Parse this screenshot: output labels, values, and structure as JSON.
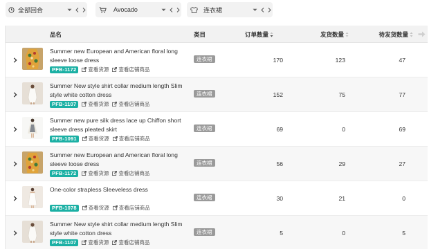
{
  "filters": [
    {
      "label": "全部回合",
      "icon": "clock-icon"
    },
    {
      "label": "Avocado",
      "icon": "cart-icon"
    },
    {
      "label": "连衣裙",
      "icon": "shirt-icon"
    }
  ],
  "table": {
    "headers": {
      "name": "品名",
      "category": "类目",
      "orders": "订单数量",
      "shipped": "发货数量",
      "pending": "待发货数量"
    },
    "link_source": "查看货源",
    "link_shop": "查看店铺商品",
    "rows": [
      {
        "title": "Summer new European and American floral long sleeve loose dress",
        "sku": "PFB-1172",
        "category": "连衣裙",
        "orders": "170",
        "shipped": "123",
        "pending": "47",
        "thumb": "floral"
      },
      {
        "title": "Summer New style shirt collar medium length Slim style white cotton dress",
        "sku": "PFB-1107",
        "category": "连衣裙",
        "orders": "152",
        "shipped": "75",
        "pending": "77",
        "thumb": "white"
      },
      {
        "title": "Summer new pure silk dress lace up Chiffon short sleeve dress pleated skirt",
        "sku": "PFB-1091",
        "category": "连衣裙",
        "orders": "69",
        "shipped": "0",
        "pending": "69",
        "thumb": "chiffon"
      },
      {
        "title": "Summer new European and American floral long sleeve loose dress",
        "sku": "PFB-1172",
        "category": "连衣裙",
        "orders": "56",
        "shipped": "29",
        "pending": "27",
        "thumb": "floral"
      },
      {
        "title": "One-color strapless Sleeveless dress",
        "sku": "PFB-1078",
        "category": "连衣裙",
        "orders": "30",
        "shipped": "21",
        "pending": "0",
        "thumb": "strapless"
      },
      {
        "title": "Summer New style shirt collar medium length Slim style white cotton dress",
        "sku": "PFB-1107",
        "category": "连衣裙",
        "orders": "5",
        "shipped": "0",
        "pending": "5",
        "thumb": "white"
      }
    ]
  },
  "colors": {
    "sku_badge": "#1bb0a4",
    "category_badge": "#9a9a9a",
    "header_bg": "#f2f2f2"
  }
}
